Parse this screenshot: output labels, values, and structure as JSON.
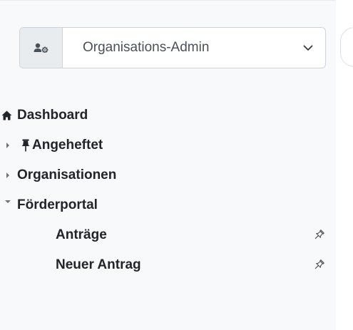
{
  "role_selector": {
    "icon": "user-gear-icon",
    "selected": "Organisations-Admin",
    "chevron": "chevron-down-icon"
  },
  "nav": {
    "dashboard": {
      "label": "Dashboard",
      "icon": "home-icon"
    },
    "pinned": {
      "label": "Angeheftet",
      "icon": "pin-icon",
      "expanded": false
    },
    "organisations": {
      "label": "Organisationen",
      "expanded": false
    },
    "foerderportal": {
      "label": "Förderportal",
      "expanded": true,
      "items": [
        {
          "label": "Anträge",
          "icon": "pin-outline-icon"
        },
        {
          "label": "Neuer Antrag",
          "icon": "pin-outline-icon"
        }
      ]
    }
  },
  "colors": {
    "text": "#212529",
    "muted": "#6c757d",
    "panel": "#f8f9fa",
    "border": "#ced4da"
  }
}
